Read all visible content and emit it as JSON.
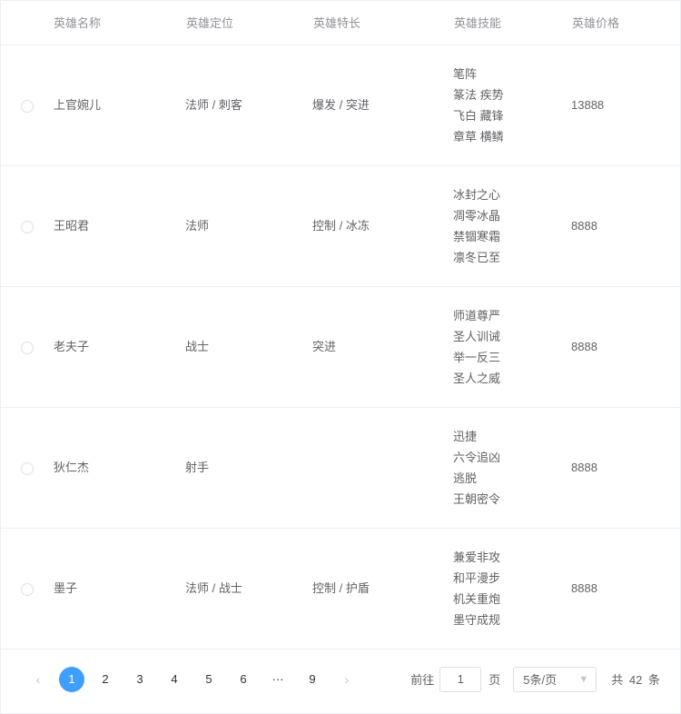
{
  "columns": {
    "name": "英雄名称",
    "position": "英雄定位",
    "speciality": "英雄特长",
    "skills": "英雄技能",
    "price": "英雄价格"
  },
  "rows": [
    {
      "name": "上官婉儿",
      "position": "法师 / 刺客",
      "speciality": "爆发 / 突进",
      "skills": [
        "笔阵",
        "篆法 疾势",
        "飞白 藏锋",
        "章草 横鳞"
      ],
      "price": "13888"
    },
    {
      "name": "王昭君",
      "position": "法师",
      "speciality": "控制 / 冰冻",
      "skills": [
        "冰封之心",
        "凋零冰晶",
        "禁锢寒霜",
        "凛冬已至"
      ],
      "price": "8888"
    },
    {
      "name": "老夫子",
      "position": "战士",
      "speciality": "突进",
      "skills": [
        "师道尊严",
        "圣人训诫",
        "举一反三",
        "圣人之威"
      ],
      "price": "8888"
    },
    {
      "name": "狄仁杰",
      "position": "射手",
      "speciality": "",
      "skills": [
        "迅捷",
        "六令追凶",
        "逃脱",
        "王朝密令"
      ],
      "price": "8888"
    },
    {
      "name": "墨子",
      "position": "法师 / 战士",
      "speciality": "控制 / 护盾",
      "skills": [
        "兼爱非攻",
        "和平漫步",
        "机关重炮",
        "墨守成规"
      ],
      "price": "8888"
    }
  ],
  "pager": {
    "pages": [
      "1",
      "2",
      "3",
      "4",
      "5",
      "6",
      "···",
      "9"
    ],
    "active": "1",
    "goto_label": "前往",
    "goto_value": "1",
    "page_suffix": "页",
    "size_label": "5条/页",
    "total_prefix": "共",
    "total_count": "42",
    "total_suffix": "条"
  }
}
